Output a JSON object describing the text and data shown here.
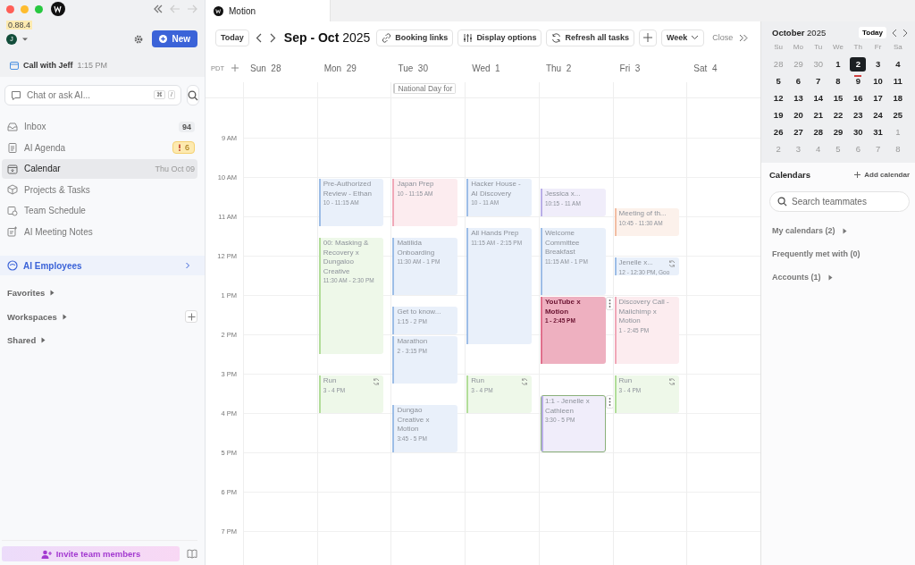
{
  "app": {
    "version": "0.88.4",
    "avatar": "J",
    "new_button": "New",
    "upcoming": {
      "title": "Call with Jeff",
      "time": "1:15 PM"
    },
    "chat": {
      "placeholder": "Chat or ask AI...",
      "keys": [
        "⌘",
        "/"
      ]
    }
  },
  "nav": [
    {
      "label": "Inbox",
      "selected": false,
      "badge": {
        "text": "94",
        "kind": "count"
      }
    },
    {
      "label": "AI Agenda",
      "selected": false,
      "badge": {
        "text": "6",
        "kind": "alert"
      }
    },
    {
      "label": "Calendar",
      "selected": true,
      "meta": "Thu Oct 09"
    },
    {
      "label": "Projects & Tasks",
      "selected": false
    },
    {
      "label": "Team Schedule",
      "selected": false
    },
    {
      "label": "AI Meeting Notes",
      "selected": false
    }
  ],
  "ai_employees": {
    "label": "AI Employees"
  },
  "sections": [
    {
      "label": "Favorites",
      "expanded": false,
      "add_button": false
    },
    {
      "label": "Workspaces",
      "expanded": false,
      "add_button": true
    },
    {
      "label": "Shared",
      "expanded": false,
      "add_button": false
    }
  ],
  "invite_button": "Invite team members",
  "tab": {
    "title": "Motion"
  },
  "toolbar": {
    "today": "Today",
    "title": "**Sep - Oct** 2025",
    "buttons": [
      "Booking links",
      "Display options",
      "Refresh all tasks"
    ],
    "view": "Week",
    "close": "Close"
  },
  "timezone": "PDT",
  "hours": [
    "9 AM",
    "10 AM",
    "11 AM",
    "12 PM",
    "1 PM",
    "2 PM",
    "3 PM",
    "4 PM",
    "5 PM",
    "6 PM",
    "7 PM"
  ],
  "days": [
    {
      "dow": "Sun",
      "date": "28"
    },
    {
      "dow": "Mon",
      "date": "29",
      "events": [
        {
          "title": "Pre-Authorized Review - Ethan",
          "time": "10 - 11:15 AM",
          "color": "#9dbde6",
          "recurring": false,
          "selected": false,
          "highlighted": false,
          "menu": false
        },
        {
          "title": "00: Masking & Recovery x Dungaloo Creative",
          "time": "11:30 AM - 2:30 PM",
          "color": "#b2dd9a",
          "recurring": false,
          "selected": false,
          "highlighted": false,
          "menu": false
        },
        {
          "title": "Run",
          "time": "3 - 4 PM",
          "color": "#b2dd9a",
          "recurring": true,
          "selected": false,
          "highlighted": false,
          "menu": false
        }
      ]
    },
    {
      "dow": "Tue",
      "date": "30",
      "all_day": [
        "National Day for"
      ],
      "events": [
        {
          "title": "Japan Prep",
          "time": "10 - 11:15 AM",
          "color": "#f0a8b8",
          "recurring": false,
          "selected": false,
          "highlighted": false,
          "menu": false
        },
        {
          "title": "Matilida Onboarding",
          "time": "11:30 AM - 1 PM",
          "color": "#9dbde6",
          "recurring": false,
          "selected": false,
          "highlighted": false,
          "menu": false
        },
        {
          "title": "Get to know...",
          "time": "1:15 - 2 PM",
          "color": "#9dbde6",
          "recurring": false,
          "selected": false,
          "highlighted": false,
          "menu": false
        },
        {
          "title": "Marathon",
          "time": "2 - 3:15 PM",
          "color": "#9dbde6",
          "recurring": false,
          "selected": false,
          "highlighted": false,
          "menu": false
        },
        {
          "title": "Dungao Creative x Motion",
          "time": "3:45 - 5 PM",
          "color": "#9dbde6",
          "recurring": false,
          "selected": false,
          "highlighted": false,
          "menu": false
        }
      ]
    },
    {
      "dow": "Wed",
      "date": "1",
      "events": [
        {
          "title": "Hacker House - AI Discovery",
          "time": "10 - 11 AM",
          "color": "#9dbde6",
          "recurring": false,
          "selected": false,
          "highlighted": false,
          "menu": false
        },
        {
          "title": "All Hands Prep",
          "time": "11:15 AM - 2:15 PM",
          "color": "#9dbde6",
          "recurring": false,
          "selected": false,
          "highlighted": false,
          "menu": false
        },
        {
          "title": "Run",
          "time": "3 - 4 PM",
          "color": "#b2dd9a",
          "recurring": true,
          "selected": false,
          "highlighted": false,
          "menu": false
        }
      ]
    },
    {
      "dow": "Thu",
      "date": "2",
      "events": [
        {
          "title": "Jessica x...",
          "time": "10:15 - 11 AM",
          "color": "#b9aee8",
          "recurring": false,
          "selected": false,
          "highlighted": false,
          "menu": false
        },
        {
          "title": "Welcome Committee Breakfast",
          "time": "11:15 AM - 1 PM",
          "color": "#9dbde6",
          "recurring": false,
          "selected": false,
          "highlighted": false,
          "menu": false
        },
        {
          "title": "YouTube x Motion",
          "time": "1 - 2:45 PM",
          "color": "#e0708c",
          "recurring": false,
          "selected": false,
          "highlighted": true,
          "menu": true
        },
        {
          "title": "1:1 - Jenelle x Cathleen",
          "time": "3:30 - 5 PM",
          "color": "#b9aee8",
          "recurring": false,
          "selected": true,
          "highlighted": false,
          "menu": true
        }
      ]
    },
    {
      "dow": "Fri",
      "date": "3",
      "events": [
        {
          "title": "Meeting of th...",
          "time": "10:45 - 11:30 AM",
          "color": "#f2bea4",
          "recurring": false,
          "selected": false,
          "highlighted": false,
          "menu": false
        },
        {
          "title": "Jenelle x...",
          "time": "12 - 12:30 PM, Goo",
          "color": "#9dbde6",
          "recurring": true,
          "selected": false,
          "highlighted": false,
          "menu": false
        },
        {
          "title": "Discovery Call - Mailchimp x Motion",
          "time": "1 - 2:45 PM",
          "color": "#f0a8b8",
          "recurring": false,
          "selected": false,
          "highlighted": false,
          "menu": false
        },
        {
          "title": "Run",
          "time": "3 - 4 PM",
          "color": "#b2dd9a",
          "recurring": true,
          "selected": false,
          "highlighted": false,
          "menu": false
        }
      ]
    },
    {
      "dow": "Sat",
      "date": "4"
    }
  ],
  "mini_calendar": {
    "title": "**October** 2025",
    "today_button": "Today",
    "weekdays": [
      "Su",
      "Mo",
      "Tu",
      "We",
      "Th",
      "Fr",
      "Sa"
    ],
    "days": [
      {
        "d": "28",
        "outside": true,
        "selected": false,
        "today": false
      },
      {
        "d": "29",
        "outside": true,
        "selected": false,
        "today": false
      },
      {
        "d": "30",
        "outside": true,
        "selected": false,
        "today": false
      },
      {
        "d": "1",
        "outside": false,
        "selected": false,
        "today": false
      },
      {
        "d": "2",
        "outside": false,
        "selected": true,
        "today": false
      },
      {
        "d": "3",
        "outside": false,
        "selected": false,
        "today": false
      },
      {
        "d": "4",
        "outside": false,
        "selected": false,
        "today": false
      },
      {
        "d": "5",
        "outside": false,
        "selected": false,
        "today": false
      },
      {
        "d": "6",
        "outside": false,
        "selected": false,
        "today": false
      },
      {
        "d": "7",
        "outside": false,
        "selected": false,
        "today": false
      },
      {
        "d": "8",
        "outside": false,
        "selected": false,
        "today": false
      },
      {
        "d": "9",
        "outside": false,
        "selected": false,
        "today": true
      },
      {
        "d": "10",
        "outside": false,
        "selected": false,
        "today": false
      },
      {
        "d": "11",
        "outside": false,
        "selected": false,
        "today": false
      },
      {
        "d": "12",
        "outside": false,
        "selected": false,
        "today": false
      },
      {
        "d": "13",
        "outside": false,
        "selected": false,
        "today": false
      },
      {
        "d": "14",
        "outside": false,
        "selected": false,
        "today": false
      },
      {
        "d": "15",
        "outside": false,
        "selected": false,
        "today": false
      },
      {
        "d": "16",
        "outside": false,
        "selected": false,
        "today": false
      },
      {
        "d": "17",
        "outside": false,
        "selected": false,
        "today": false
      },
      {
        "d": "18",
        "outside": false,
        "selected": false,
        "today": false
      },
      {
        "d": "19",
        "outside": false,
        "selected": false,
        "today": false
      },
      {
        "d": "20",
        "outside": false,
        "selected": false,
        "today": false
      },
      {
        "d": "21",
        "outside": false,
        "selected": false,
        "today": false
      },
      {
        "d": "22",
        "outside": false,
        "selected": false,
        "today": false
      },
      {
        "d": "23",
        "outside": false,
        "selected": false,
        "today": false
      },
      {
        "d": "24",
        "outside": false,
        "selected": false,
        "today": false
      },
      {
        "d": "25",
        "outside": false,
        "selected": false,
        "today": false
      },
      {
        "d": "26",
        "outside": false,
        "selected": false,
        "today": false
      },
      {
        "d": "27",
        "outside": false,
        "selected": false,
        "today": false
      },
      {
        "d": "28",
        "outside": false,
        "selected": false,
        "today": false
      },
      {
        "d": "29",
        "outside": false,
        "selected": false,
        "today": false
      },
      {
        "d": "30",
        "outside": false,
        "selected": false,
        "today": false
      },
      {
        "d": "31",
        "outside": false,
        "selected": false,
        "today": false
      },
      {
        "d": "1",
        "outside": true,
        "selected": false,
        "today": false
      },
      {
        "d": "2",
        "outside": true,
        "selected": false,
        "today": false
      },
      {
        "d": "3",
        "outside": true,
        "selected": false,
        "today": false
      },
      {
        "d": "4",
        "outside": true,
        "selected": false,
        "today": false
      },
      {
        "d": "5",
        "outside": true,
        "selected": false,
        "today": false
      },
      {
        "d": "6",
        "outside": true,
        "selected": false,
        "today": false
      },
      {
        "d": "7",
        "outside": true,
        "selected": false,
        "today": false
      },
      {
        "d": "8",
        "outside": true,
        "selected": false,
        "today": false
      }
    ]
  },
  "calendars": {
    "title": "Calendars",
    "add": "Add calendar",
    "search_placeholder": "Search teammates",
    "groups": [
      {
        "label": "My calendars (2)",
        "expandable": true
      },
      {
        "label": "Frequently met with (0)",
        "expandable": false
      },
      {
        "label": "Accounts (1)",
        "expandable": true
      }
    ]
  }
}
